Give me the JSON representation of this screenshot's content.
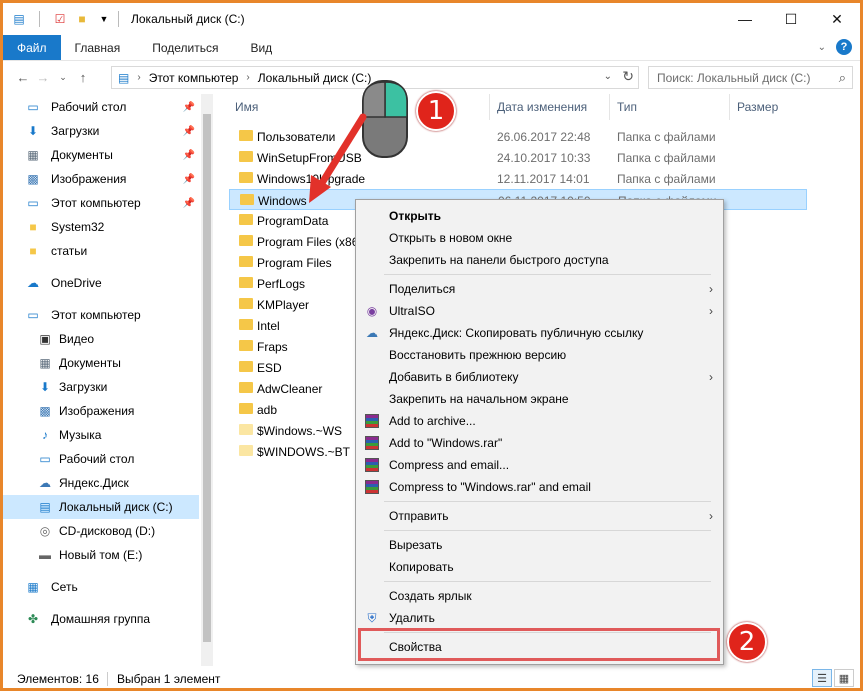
{
  "window": {
    "title": "Локальный диск (C:)"
  },
  "ribbon": {
    "tabs": [
      "Файл",
      "Главная",
      "Поделиться",
      "Вид"
    ]
  },
  "address": {
    "crumbs": [
      "Этот компьютер",
      "Локальный диск (C:)"
    ],
    "search_placeholder": "Поиск: Локальный диск (C:)"
  },
  "sidebar": {
    "items": [
      {
        "label": "Рабочий стол",
        "icon": "desktop-icon",
        "pinned": true
      },
      {
        "label": "Загрузки",
        "icon": "download-icon",
        "pinned": true
      },
      {
        "label": "Документы",
        "icon": "documents-icon",
        "pinned": true
      },
      {
        "label": "Изображения",
        "icon": "pictures-icon",
        "pinned": true
      },
      {
        "label": "Этот компьютер",
        "icon": "computer-icon",
        "pinned": true
      },
      {
        "label": "System32",
        "icon": "folder-icon",
        "pinned": false
      },
      {
        "label": "статьи",
        "icon": "folder-icon",
        "pinned": false
      },
      {
        "label": "OneDrive",
        "icon": "cloud-icon",
        "pinned": false
      },
      {
        "label": "Этот компьютер",
        "icon": "computer-icon",
        "pinned": false
      },
      {
        "label": "Видео",
        "icon": "video-icon",
        "pinned": false
      },
      {
        "label": "Документы",
        "icon": "documents-icon",
        "pinned": false
      },
      {
        "label": "Загрузки",
        "icon": "download-icon",
        "pinned": false
      },
      {
        "label": "Изображения",
        "icon": "pictures-icon",
        "pinned": false
      },
      {
        "label": "Музыка",
        "icon": "music-icon",
        "pinned": false
      },
      {
        "label": "Рабочий стол",
        "icon": "desktop-icon",
        "pinned": false
      },
      {
        "label": "Яндекс.Диск",
        "icon": "yandex-disk-icon",
        "pinned": false
      },
      {
        "label": "Локальный диск (C:)",
        "icon": "drive-icon",
        "pinned": false
      },
      {
        "label": "CD-дисковод (D:)",
        "icon": "cd-icon",
        "pinned": false
      },
      {
        "label": "Новый том (E:)",
        "icon": "drive-icon",
        "pinned": false
      },
      {
        "label": "Сеть",
        "icon": "network-icon",
        "pinned": false
      },
      {
        "label": "Домашняя группа",
        "icon": "homegroup-icon",
        "pinned": false
      }
    ]
  },
  "columns": [
    "Имя",
    "Дата изменения",
    "Тип",
    "Размер"
  ],
  "files": [
    {
      "name": "Пользователи",
      "date": "26.06.2017 22:48",
      "type": "Папка с файлами"
    },
    {
      "name": "WinSetupFromUSB",
      "date": "24.10.2017 10:33",
      "type": "Папка с файлами"
    },
    {
      "name": "Windows10Upgrade",
      "date": "12.11.2017 14:01",
      "type": "Папка с файлами"
    },
    {
      "name": "Windows",
      "date": "06.11.2017 10:50",
      "type": "Папка с файлами"
    },
    {
      "name": "ProgramData",
      "date": "",
      "type": ""
    },
    {
      "name": "Program Files (x86)",
      "date": "",
      "type": ""
    },
    {
      "name": "Program Files",
      "date": "",
      "type": ""
    },
    {
      "name": "PerfLogs",
      "date": "",
      "type": ""
    },
    {
      "name": "KMPlayer",
      "date": "",
      "type": ""
    },
    {
      "name": "Intel",
      "date": "",
      "type": ""
    },
    {
      "name": "Fraps",
      "date": "",
      "type": ""
    },
    {
      "name": "ESD",
      "date": "",
      "type": ""
    },
    {
      "name": "AdwCleaner",
      "date": "",
      "type": ""
    },
    {
      "name": "adb",
      "date": "",
      "type": ""
    },
    {
      "name": "$Windows.~WS",
      "date": "",
      "type": ""
    },
    {
      "name": "$WINDOWS.~BT",
      "date": "",
      "type": ""
    }
  ],
  "context_menu": {
    "items": [
      {
        "label": "Открыть",
        "bold": true
      },
      {
        "label": "Открыть в новом окне"
      },
      {
        "label": "Закрепить на панели быстрого доступа"
      },
      {
        "label": "Поделиться",
        "submenu": true
      },
      {
        "label": "UltraISO",
        "submenu": true,
        "icon": "ultraiso-icon"
      },
      {
        "label": "Яндекс.Диск: Скопировать публичную ссылку",
        "icon": "yandex-disk-icon"
      },
      {
        "label": "Восстановить прежнюю версию"
      },
      {
        "label": "Добавить в библиотеку",
        "submenu": true
      },
      {
        "label": "Закрепить на начальном экране"
      },
      {
        "label": "Add to archive...",
        "icon": "winrar-icon"
      },
      {
        "label": "Add to \"Windows.rar\"",
        "icon": "winrar-icon"
      },
      {
        "label": "Compress and email...",
        "icon": "winrar-icon"
      },
      {
        "label": "Compress to \"Windows.rar\" and email",
        "icon": "winrar-icon"
      },
      {
        "label": "Отправить",
        "submenu": true
      },
      {
        "label": "Вырезать"
      },
      {
        "label": "Копировать"
      },
      {
        "label": "Создать ярлык"
      },
      {
        "label": "Удалить",
        "icon": "shield-icon"
      },
      {
        "label": "Свойства"
      }
    ]
  },
  "annotations": {
    "badge1": "1",
    "badge2": "2"
  },
  "status": {
    "count": "Элементов: 16",
    "selected": "Выбран 1 элемент"
  },
  "colors": {
    "accent": "#1979ca",
    "frame": "#e8862a",
    "selection": "#cce8ff",
    "badge": "#e0241b"
  }
}
